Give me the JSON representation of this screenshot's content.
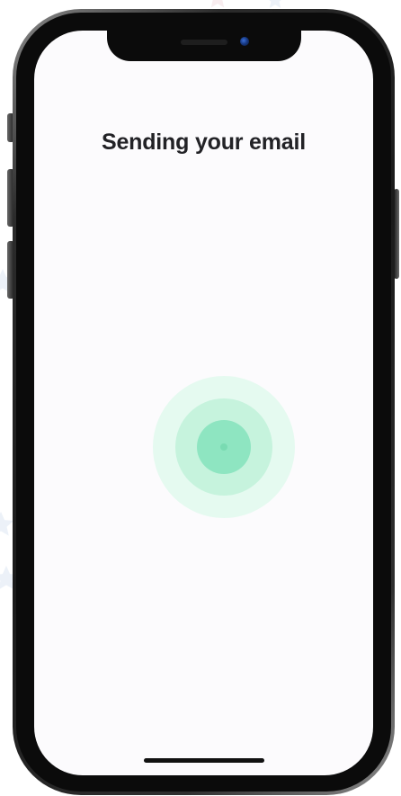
{
  "screen": {
    "title": "Sending your email"
  },
  "indicator": {
    "icon": "sending-pulse-icon",
    "colors": {
      "outer": "#e5faf0",
      "middle": "#c6f3dd",
      "inner": "#8ee5c1"
    }
  },
  "background": {
    "decoration_icon": "star-icon",
    "decoration_color": "#dde7f4"
  },
  "device": {
    "frame_color": "#1a1a1a",
    "screen_color": "#fcfbfd"
  }
}
